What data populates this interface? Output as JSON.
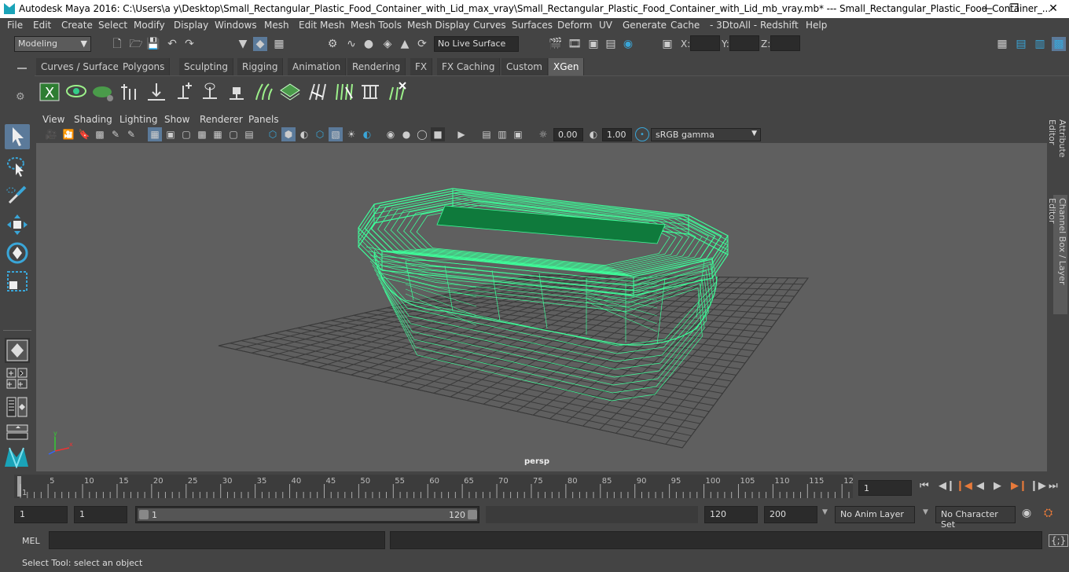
{
  "window": {
    "title": "Autodesk Maya 2016: C:\\Users\\a y\\Desktop\\Small_Rectangular_Plastic_Food_Container_with_Lid_max_vray\\Small_Rectangular_Plastic_Food_Container_with_Lid_mb_vray.mb*   ---   Small_Rectangular_Plastic_Food_Container_..."
  },
  "menus": [
    "File",
    "Edit",
    "Create",
    "Select",
    "Modify",
    "Display",
    "Windows",
    "Mesh",
    "Edit Mesh",
    "Mesh Tools",
    "Mesh Display",
    "Curves",
    "Surfaces",
    "Deform",
    "UV",
    "Generate",
    "Cache",
    "- 3DtoAll -",
    "Redshift",
    "Help"
  ],
  "statusline": {
    "mode": "Modeling",
    "live_surface": "No Live Surface",
    "x_label": "X:",
    "y_label": "Y:",
    "z_label": "Z:"
  },
  "shelf_tabs": [
    "Curves / Surfaces",
    "Polygons",
    "Sculpting",
    "Rigging",
    "Animation",
    "Rendering",
    "FX",
    "FX Caching",
    "Custom",
    "XGen"
  ],
  "active_shelf": "XGen",
  "panel_menu": [
    "View",
    "Shading",
    "Lighting",
    "Show",
    "Renderer",
    "Panels"
  ],
  "panel_tools": {
    "exposure": "0.00",
    "gamma": "1.00",
    "color_space": "sRGB gamma"
  },
  "viewport": {
    "camera_label": "persp",
    "wire_color": "#3dff9a"
  },
  "right_tabs": [
    "Attribute Editor",
    "Channel Box / Layer Editor"
  ],
  "timeline": {
    "ticks": [
      "1",
      "5",
      "10",
      "15",
      "20",
      "25",
      "30",
      "35",
      "40",
      "45",
      "50",
      "55",
      "60",
      "65",
      "70",
      "75",
      "80",
      "85",
      "90",
      "95",
      "100",
      "105",
      "110",
      "115",
      "12"
    ],
    "current_frame": "1"
  },
  "range": {
    "start": "1",
    "playback_start": "1",
    "slider_start": "1",
    "slider_end": "120",
    "playback_end": "120",
    "end": "200",
    "anim_layer": "No Anim Layer",
    "character_set": "No Character Set"
  },
  "mel": {
    "label": "MEL"
  },
  "status_message": "Select Tool: select an object"
}
